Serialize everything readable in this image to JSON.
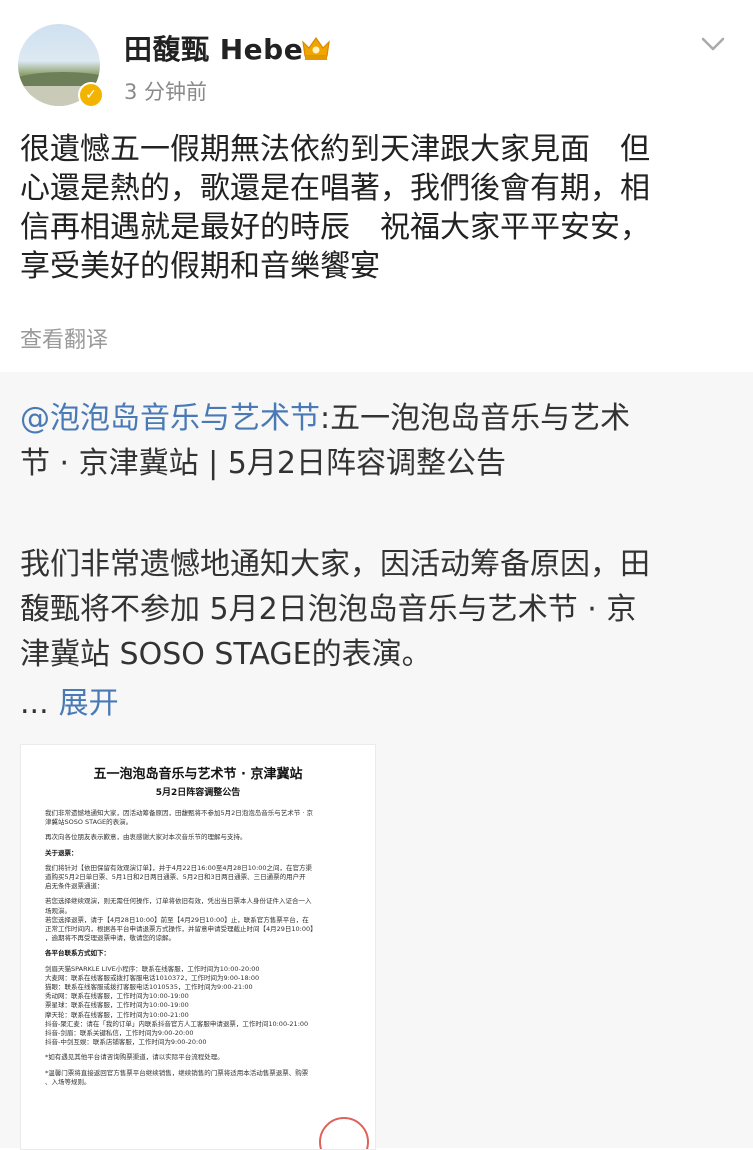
{
  "post": {
    "author": "田馥甄 Hebe",
    "time": "3 分钟前",
    "content_lines": [
      "很遺憾五一假期無法依約到天津跟大家見面　但",
      "心還是熱的，歌還是在唱著，我們後會有期，相",
      "信再相遇就是最好的時辰　祝福大家平平安安，",
      "享受美好的假期和音樂饗宴"
    ],
    "translate_label": "查看翻译",
    "icons": {
      "avatar": "avatar",
      "verified": "verified-badge-icon",
      "crown": "crown-icon",
      "menu": "chevron-down-icon"
    }
  },
  "repost": {
    "mention": "@泡泡岛音乐与艺术节",
    "title_rest": ":五一泡泡岛音乐与艺术",
    "title_line2": "节 · 京津冀站 | 5月2日阵容调整公告",
    "body_lines": [
      "我们非常遗憾地通知大家，因活动筹备原因，田",
      "馥甄将不参加 5月2日泡泡岛音乐与艺术节 · 京",
      "津冀站 SOSO STAGE的表演。"
    ],
    "ellipsis": "...",
    "expand_label": "展开"
  },
  "document": {
    "title": "五一泡泡岛音乐与艺术节 · 京津冀站",
    "subtitle": "5月2日阵容调整公告",
    "lines": [
      {
        "t": "我们非常遗憾地通知大家，因活动筹备原因，田馥甄将不参加5月2日泡泡岛音乐与艺术节 · 京",
        "b": false
      },
      {
        "t": "津冀站SOSO STAGE的表演。",
        "b": false
      },
      {
        "t": "",
        "gap": true
      },
      {
        "t": "再次向各位朋友表示歉意，由衷感谢大家对本次音乐节的理解与支持。",
        "b": false
      },
      {
        "t": "",
        "gap": true
      },
      {
        "t": "关于退票：",
        "b": true
      },
      {
        "t": "",
        "gap": true
      },
      {
        "t": "我们将针对【依田保留有效观演订单】，并于4月22日16:00至4月28日10:00之间，在官方渠",
        "b": false
      },
      {
        "t": "道购买5月2日单日票、5月1日和2日两日通票、5月2日和3日两日通票、三日通票的用户开",
        "b": false
      },
      {
        "t": "启无条件退票通道：",
        "b": false
      },
      {
        "t": "",
        "gap": true
      },
      {
        "t": "若您选择继续观演，则无需任何操作，订单将依旧有效，凭出当日票本人身份证件入证合一入",
        "b": false
      },
      {
        "t": "场观演。",
        "b": false
      },
      {
        "t": "若您选择退票，请于【4月28日10:00】前至【4月29日10:00】止，联系官方售票平台，在",
        "b": false
      },
      {
        "t": "正常工作时间内，根据各平台申请退票方式操作，并留意申请受理截止时间【4月29日10:00】",
        "b": false
      },
      {
        "t": "，逾期将不再受理退票申请，敬请您的谅解。",
        "b": false
      },
      {
        "t": "",
        "gap": true
      },
      {
        "t": "各平台联系方式如下：",
        "b": true
      },
      {
        "t": "",
        "gap": true
      },
      {
        "t": "剑眉天猫SPARKLE LIVE小程序：联系在线客服，工作时间为10:00-20:00",
        "b": false
      },
      {
        "t": "大麦网：联系在线客服或拨打客服电话1010372，工作时间为9:00-18:00",
        "b": false
      },
      {
        "t": "猫眼：联系在线客服或拨打客服电话1010535，工作时间为9:00-21:00",
        "b": false
      },
      {
        "t": "秀动网：联系在线客服，工作时间为10:00-19:00",
        "b": false
      },
      {
        "t": "票星球：联系在线客服，工作时间为10:00-19:00",
        "b": false
      },
      {
        "t": "摩天轮：联系在线客服，工作时间为10:00-21:00",
        "b": false
      },
      {
        "t": "抖音-聚汇麦：请在「我的订单」内联系抖音官方人工客服申请退票，工作时间10:00-21:00",
        "b": false
      },
      {
        "t": "抖音-剑眉：联系关键私信，工作时间为9:00-20:00",
        "b": false
      },
      {
        "t": "抖音-中剑互娱：联系店铺客服，工作时间为9:00-20:00",
        "b": false
      },
      {
        "t": "",
        "gap": true
      },
      {
        "t": "*如有遇见其他平台请咨询购票渠道，请以实际平台流程处理。",
        "b": false
      },
      {
        "t": "",
        "gap": true
      },
      {
        "t": "*温馨门票将直接返回官方售票平台继续销售，继续销售的门票将适用本活动售票退票、购票",
        "b": false
      },
      {
        "t": "、入场等规则。",
        "b": false
      }
    ]
  },
  "colors": {
    "link": "#4a7ab5",
    "text": "#222222",
    "muted": "#8a8a8a",
    "repost_bg": "#f7f7f7",
    "badge": "#f2b400"
  }
}
